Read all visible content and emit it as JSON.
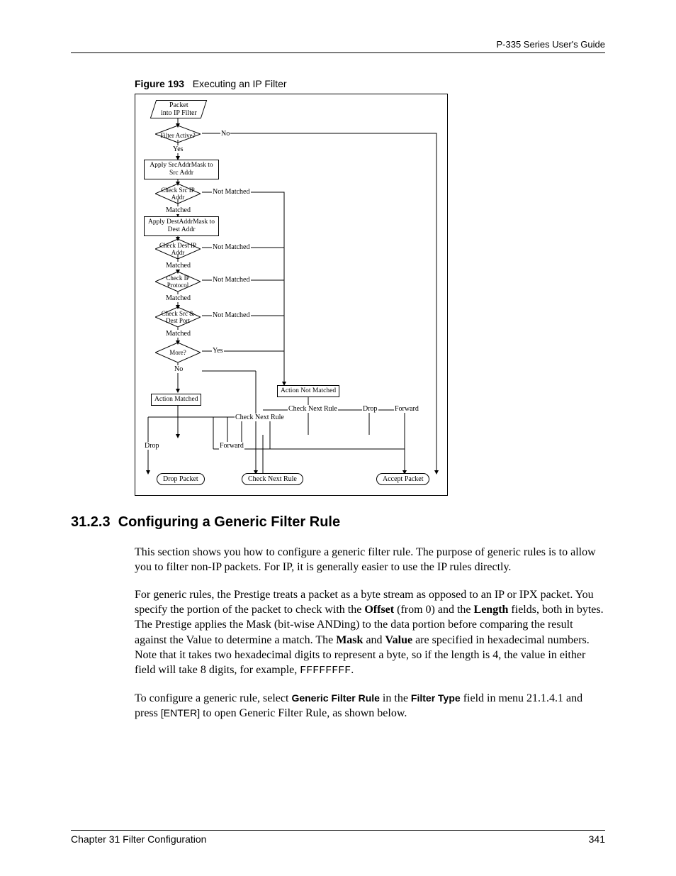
{
  "header": {
    "right": "P-335 Series User's Guide"
  },
  "figure": {
    "number": "Figure 193",
    "title": "Executing an IP Filter"
  },
  "flowchart": {
    "start": "Packet\ninto IP Filter",
    "d1": "Filter Active?",
    "d1_no": "No",
    "d1_yes": "Yes",
    "r1": "Apply SrcAddrMask\nto Src Addr",
    "d2": "Check Src\nIP Addr",
    "d2_nm": "Not Matched",
    "d2_m": "Matched",
    "r2": "Apply DestAddrMask\nto Dest Addr",
    "d3": "Check Dest\nIP Addr",
    "d3_nm": "Not Matched",
    "d3_m": "Matched",
    "d4": "Check\nIP Protocol",
    "d4_nm": "Not Matched",
    "d4_m": "Matched",
    "d5": "Check Src &\nDest Port",
    "d5_nm": "Not Matched",
    "d5_m": "Matched",
    "d6": "More?",
    "d6_yes": "Yes",
    "d6_no": "No",
    "action_matched": "Action Matched",
    "action_not_matched": "Action Not Matched",
    "check_next_rule1": "Check Next Rule",
    "check_next_rule2": "Check Next Rule",
    "drop1": "Drop",
    "drop2": "Drop",
    "forward1": "Forward",
    "forward2": "Forward",
    "t_drop": "Drop Packet",
    "t_check": "Check Next Rule",
    "t_accept": "Accept Packet"
  },
  "section": {
    "number": "31.2.3",
    "title": "Configuring a Generic Filter Rule"
  },
  "para1": {
    "t1": " This section shows you how to configure a generic filter rule. The purpose of generic rules is to allow you to filter non-IP packets. For IP, it is generally easier to use the IP rules directly."
  },
  "para2": {
    "t1": "For generic rules, the Prestige treats a packet as a byte stream as opposed to an IP or IPX packet. You specify the portion of the packet to check with the ",
    "b1": "Offset",
    "t2": " (from 0) and the ",
    "b2": "Length",
    "t3": " fields, both in bytes. The Prestige applies the Mask (bit-wise ANDing) to the data portion before comparing the result against the Value to determine a match. The ",
    "b3": "Mask",
    "t4": " and ",
    "b4": "Value",
    "t5": " are specified in hexadecimal numbers. Note that it takes two hexadecimal digits to represent a byte, so if the length is 4, the value in either field will take 8 digits, for example, ",
    "m1": "FFFFFFFF",
    "t6": "."
  },
  "para3": {
    "t1": "To configure a generic rule, select ",
    "sb1": "Generic Filter Rule",
    "t2": " in the ",
    "sb2": "Filter Type",
    "t3": " field in menu 21.1.4.1 and press ",
    "s1": "[ENTER]",
    "t4": " to open Generic Filter Rule, as shown below."
  },
  "footer": {
    "left": "Chapter 31 Filter Configuration",
    "right": "341"
  }
}
